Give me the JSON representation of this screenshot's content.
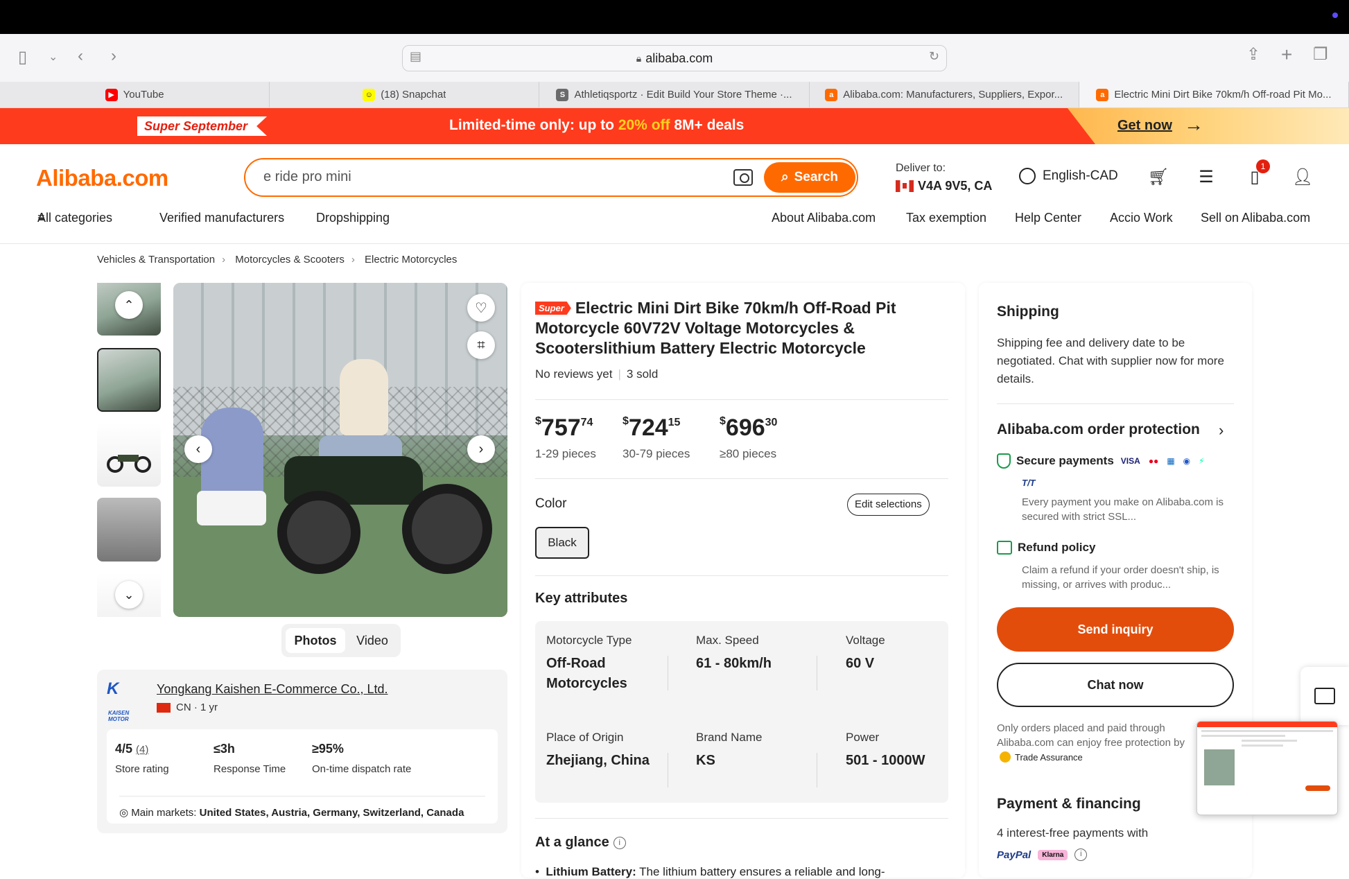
{
  "browser": {
    "url": "alibaba.com",
    "tabs": [
      {
        "label": "YouTube",
        "icon": "youtube-icon",
        "color": "#ff0000"
      },
      {
        "label": "(18) Snapchat",
        "icon": "snapchat-icon",
        "color": "#fffc00"
      },
      {
        "label": "Athletiqsportz · Edit Build Your Store Theme ·...",
        "icon": "shopify-icon",
        "color": "#6b6b6b"
      },
      {
        "label": "Alibaba.com: Manufacturers, Suppliers, Expor...",
        "icon": "alibaba-icon",
        "color": "#ff6a00"
      },
      {
        "label": "Electric Mini Dirt Bike 70km/h Off-road Pit Mo...",
        "icon": "alibaba-icon",
        "color": "#ff6a00"
      }
    ]
  },
  "promo": {
    "badge": "Super September",
    "msg_prefix": "Limited-time only: up to ",
    "msg_highlight": "20% off",
    "msg_suffix": " 8M+ deals",
    "cta": "Get now"
  },
  "header": {
    "logo": "Alibaba.com",
    "search_value": "e ride pro mini",
    "search_button": "Search",
    "deliver_label": "Deliver to:",
    "deliver_location": "V4A 9V5, CA",
    "language": "English-CAD",
    "orders_badge": "1"
  },
  "nav": {
    "all_categories": "All categories",
    "verified": "Verified manufacturers",
    "dropshipping": "Dropshipping",
    "about": "About Alibaba.com",
    "tax": "Tax exemption",
    "help": "Help Center",
    "accio": "Accio Work",
    "sell": "Sell on Alibaba.com"
  },
  "breadcrumb": [
    "Vehicles & Transportation",
    "Motorcycles & Scooters",
    "Electric Motorcycles"
  ],
  "gallery": {
    "tab_photos": "Photos",
    "tab_video": "Video"
  },
  "supplier": {
    "name": "Yongkang Kaishen E-Commerce Co., Ltd.",
    "logo_text": "KAISEN MOTOR",
    "country": "CN",
    "years": "1 yr",
    "rating": "4/5",
    "rating_count": "(4)",
    "rating_label": "Store rating",
    "response": "≤3h",
    "response_label": "Response Time",
    "ontime": "≥95%",
    "ontime_label": "On-time dispatch rate",
    "markets_label": "Main markets:",
    "markets": "United States, Austria, Germany, Switzerland, Canada"
  },
  "product": {
    "badge": "Super",
    "title": "Electric Mini Dirt Bike 70km/h Off-Road Pit Motorcycle 60V72V Voltage Motorcycles & Scooterslithium Battery Electric Motorcycle",
    "reviews": "No reviews yet",
    "sold": "3 sold",
    "tiers": [
      {
        "int": "757",
        "cents": "74",
        "qty": "1-29 pieces"
      },
      {
        "int": "724",
        "cents": "15",
        "qty": "30-79 pieces"
      },
      {
        "int": "696",
        "cents": "30",
        "qty": "≥80 pieces"
      }
    ],
    "currency": "$",
    "color_label": "Color",
    "edit_label": "Edit selections",
    "color_value": "Black",
    "key_attributes_label": "Key attributes",
    "attributes": [
      {
        "k": "Motorcycle Type",
        "v": "Off-Road Motorcycles"
      },
      {
        "k": "Max. Speed",
        "v": "61 - 80km/h"
      },
      {
        "k": "Voltage",
        "v": "60 V"
      },
      {
        "k": "Place of Origin",
        "v": "Zhejiang, China"
      },
      {
        "k": "Brand Name",
        "v": "KS"
      },
      {
        "k": "Power",
        "v": "501 - 1000W"
      }
    ],
    "glance_label": "At a glance",
    "bullet_bold": "Lithium Battery:",
    "bullet_text": " The lithium battery ensures a reliable and long-"
  },
  "shipping": {
    "title": "Shipping",
    "text": "Shipping fee and delivery date to be negotiated. Chat with supplier now for more details.",
    "protection_title": "Alibaba.com order protection",
    "secure_label": "Secure payments",
    "card_logos": [
      "VISA",
      "●●",
      "▦",
      "◉",
      "⚡"
    ],
    "tt_label": "T/T",
    "secure_text": "Every payment you make on Alibaba.com is secured with strict SSL...",
    "refund_label": "Refund policy",
    "refund_text": "Claim a refund if your order doesn't ship, is missing, or arrives with produc...",
    "send_inquiry": "Send inquiry",
    "chat_now": "Chat now",
    "protection_note": "Only orders placed and paid through Alibaba.com can enjoy free protection by",
    "trade_assurance": "Trade Assurance",
    "payment_title": "Payment & financing",
    "interest": "4 interest-free payments with",
    "paypal": "PayPal",
    "klarna": "Klarna"
  },
  "colors": {
    "brand": "#ff6a00",
    "promo": "#ff3b1d",
    "cta": "#e34d0c",
    "secure": "#1a9b4b"
  }
}
